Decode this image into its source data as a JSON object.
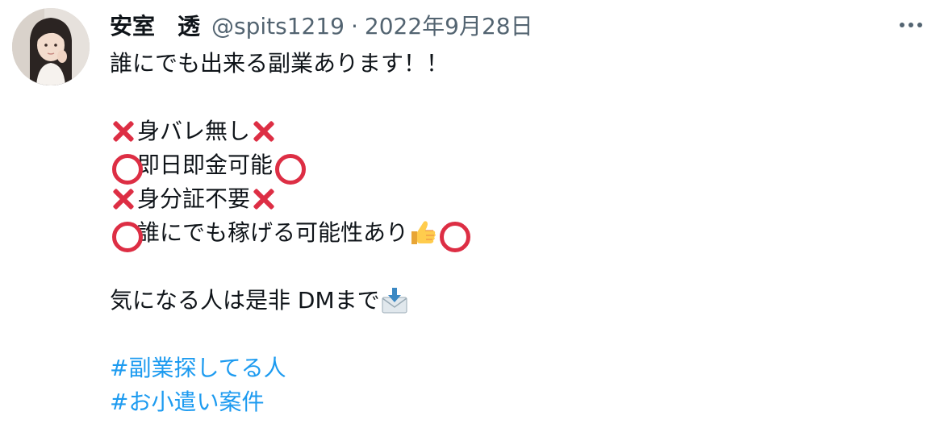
{
  "tweet": {
    "author": {
      "display_name": "安室　透",
      "handle": "@spits1219",
      "separator": "·",
      "date": "2022年9月28日"
    },
    "lines": {
      "l1": "誰にでも出来る副業あります！！",
      "l2": "身バレ無し",
      "l3": "即日即金可能",
      "l4": "身分証不要",
      "l5": "誰にでも稼げる可能性あり",
      "l6": "気になる人は是非 DMまで"
    },
    "hashtags": [
      "#副業探してる人",
      "#お小遣い案件"
    ],
    "icons": {
      "cross": "cross-mark-icon",
      "circle": "hollow-red-circle-icon",
      "thumbs": "thumbs-up-icon",
      "envelope": "envelope-with-arrow-icon",
      "more": "more-options-icon"
    },
    "colors": {
      "text": "#0f1419",
      "secondary": "#536471",
      "link": "#1d9bf0",
      "red_mark": "#dd2e44"
    }
  }
}
